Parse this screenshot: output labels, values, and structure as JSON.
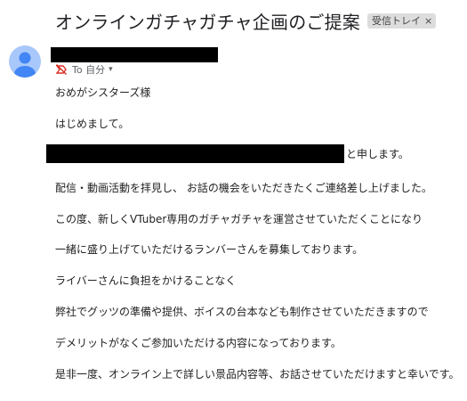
{
  "email": {
    "subject": "オンラインガチャガチャ企画のご提案",
    "label_chip": "受信トレイ",
    "label_remove": "×",
    "recipient": "To 自分",
    "recipient_caret": "▾",
    "body": {
      "greeting": "おめがシスターズ様",
      "intro": "はじめまして。",
      "name_tail": "と申します。",
      "line1": "配信・動画活動を拝見し、 お話の機会をいただきたくご連絡差し上げました。",
      "line2": "この度、新しくVTuber専用のガチャガチャを運営させていただくことになり",
      "line3": "一緒に盛り上げていただけるランバーさんを募集しております。",
      "line4": "ライバーさんに負担をかけることなく",
      "line5": "弊社でグッツの準備や提供、ボイスの台本なども制作させていただきますので",
      "line6": "デメリットがなくご参加いただける内容になっております。",
      "line7": "是非一度、オンライン上で詳しい景品内容等、お話させていただけますと幸いです。"
    }
  },
  "icons": {
    "avatar": "person-avatar-icon",
    "importance": "importance-muted-icon",
    "caret": "chevron-down-icon"
  },
  "colors": {
    "avatar_bg": "#a8c7fa",
    "avatar_fg": "#4285f4",
    "importance_red": "#d93025",
    "chip_bg": "#dddddd",
    "redaction": "#000000"
  }
}
